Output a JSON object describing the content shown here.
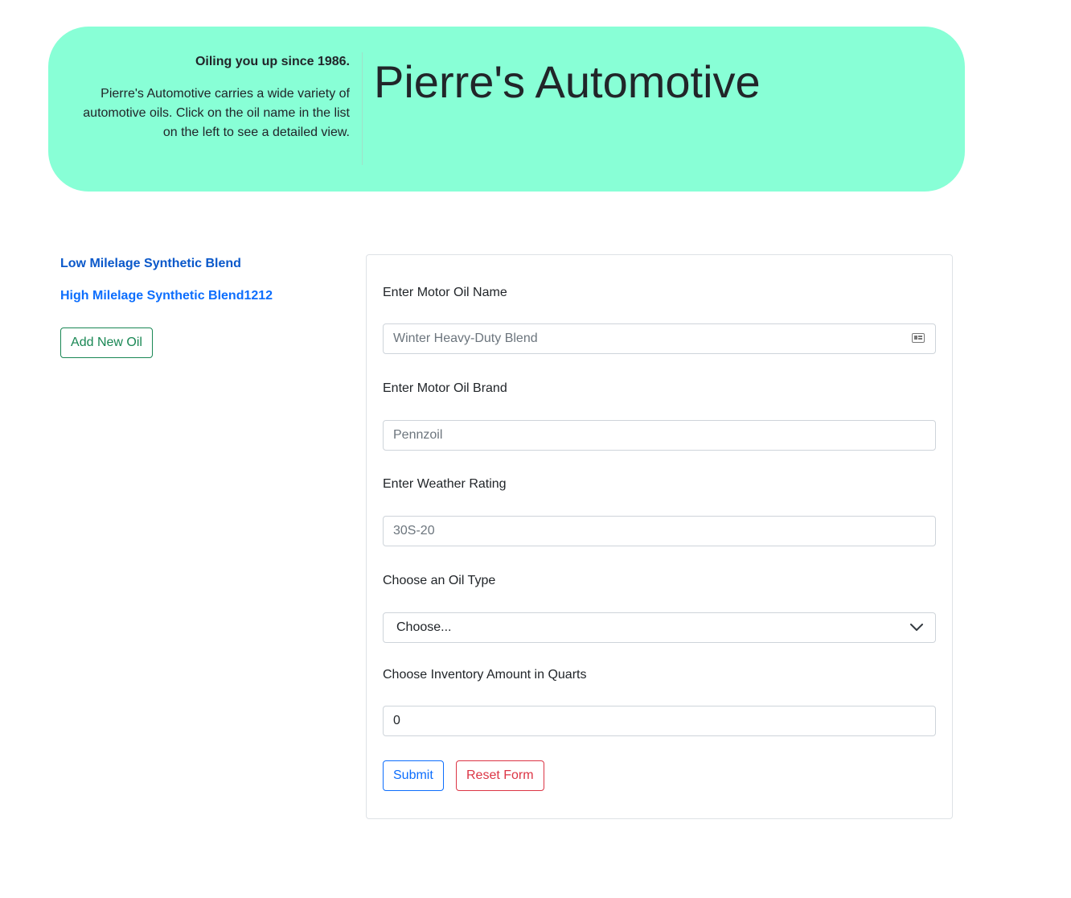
{
  "header": {
    "tagline": "Oiling you up since 1986.",
    "description": "Pierre's Automotive carries a wide variety of automotive oils. Click on the oil name in the list on the left to see a detailed view.",
    "title": "Pierre's Automotive"
  },
  "oil_list": {
    "items": [
      {
        "label": "Low Milelage Synthetic Blend"
      },
      {
        "label": "High Milelage Synthetic Blend1212"
      }
    ],
    "add_button": "Add New Oil"
  },
  "form": {
    "name": {
      "label": "Enter Motor Oil Name",
      "placeholder": "Winter Heavy-Duty Blend",
      "value": ""
    },
    "brand": {
      "label": "Enter Motor Oil Brand",
      "placeholder": "Pennzoil",
      "value": ""
    },
    "weather": {
      "label": "Enter Weather Rating",
      "placeholder": "30S-20",
      "value": ""
    },
    "oil_type": {
      "label": "Choose an Oil Type",
      "selected": "Choose..."
    },
    "quantity": {
      "label": "Choose Inventory Amount in Quarts",
      "value": "0"
    },
    "submit_label": "Submit",
    "reset_label": "Reset Form"
  },
  "colors": {
    "jumbotron_bg": "#88ffd6",
    "link_primary": "#0d6efd",
    "success": "#198754",
    "danger": "#dc3545"
  },
  "icons": {
    "name_field_icon": "contact-card-icon",
    "select_icon": "chevron-down-icon"
  }
}
